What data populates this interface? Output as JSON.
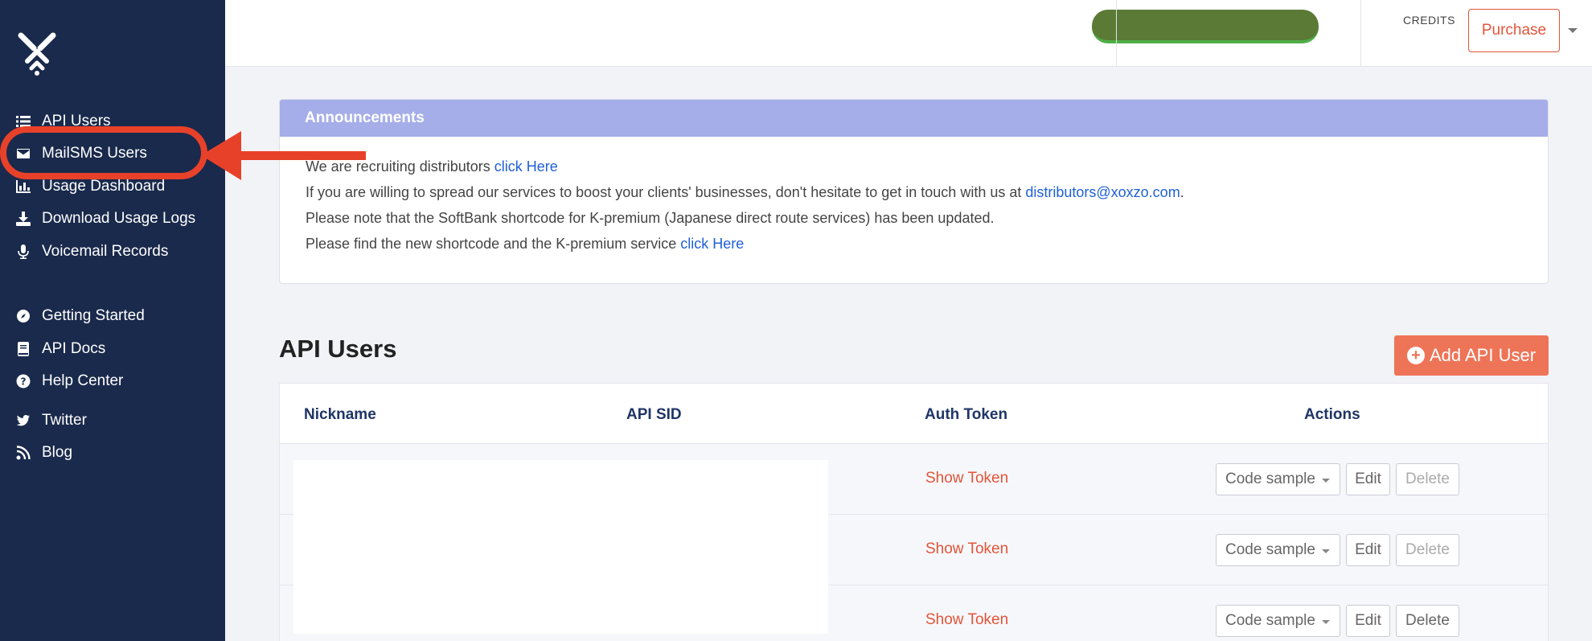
{
  "sidebar": {
    "items": [
      {
        "label": "API Users",
        "icon": "list-icon"
      },
      {
        "label": "MailSMS Users",
        "icon": "envelope-icon"
      },
      {
        "label": "Usage Dashboard",
        "icon": "bar-chart-icon"
      },
      {
        "label": "Download Usage Logs",
        "icon": "download-icon"
      },
      {
        "label": "Voicemail Records",
        "icon": "microphone-icon"
      },
      {
        "label": "Getting Started",
        "icon": "compass-icon"
      },
      {
        "label": "API Docs",
        "icon": "book-icon"
      },
      {
        "label": "Help Center",
        "icon": "question-circle-icon"
      },
      {
        "label": "Twitter",
        "icon": "twitter-icon"
      },
      {
        "label": "Blog",
        "icon": "rss-icon"
      }
    ]
  },
  "header": {
    "credits_label": "CREDITS",
    "purchase_label": "Purchase"
  },
  "announcements": {
    "title": "Announcements",
    "lines": [
      {
        "text": "We are recruiting distributors ",
        "link": "click Here",
        "after": ""
      },
      {
        "text": "If you are willing to spread our services to boost your clients' businesses, don't hesitate to get in touch with us at ",
        "link": "distributors@xoxzo.com",
        "after": "."
      },
      {
        "text": "Please note that the SoftBank shortcode for K-premium (Japanese direct route services) has been updated.",
        "link": "",
        "after": ""
      },
      {
        "text": "Please find the new shortcode and the K-premium service ",
        "link": "click Here",
        "after": ""
      }
    ]
  },
  "api_users": {
    "title": "API Users",
    "add_label": "Add API User",
    "columns": [
      "Nickname",
      "API SID",
      "Auth Token",
      "Actions"
    ],
    "rows": [
      {
        "token_label": "Show Token",
        "code_label": "Code sample",
        "edit_label": "Edit",
        "delete_label": "Delete",
        "delete_enabled": false
      },
      {
        "token_label": "Show Token",
        "code_label": "Code sample",
        "edit_label": "Edit",
        "delete_label": "Delete",
        "delete_enabled": false
      },
      {
        "token_label": "Show Token",
        "code_label": "Code sample",
        "edit_label": "Edit",
        "delete_label": "Delete",
        "delete_enabled": true
      }
    ]
  },
  "colors": {
    "sidebar_bg": "#1a2a4c",
    "accent": "#e2553a",
    "announcement_header": "#a5aee8",
    "link": "#2060d8",
    "annotation": "#e8412a"
  }
}
